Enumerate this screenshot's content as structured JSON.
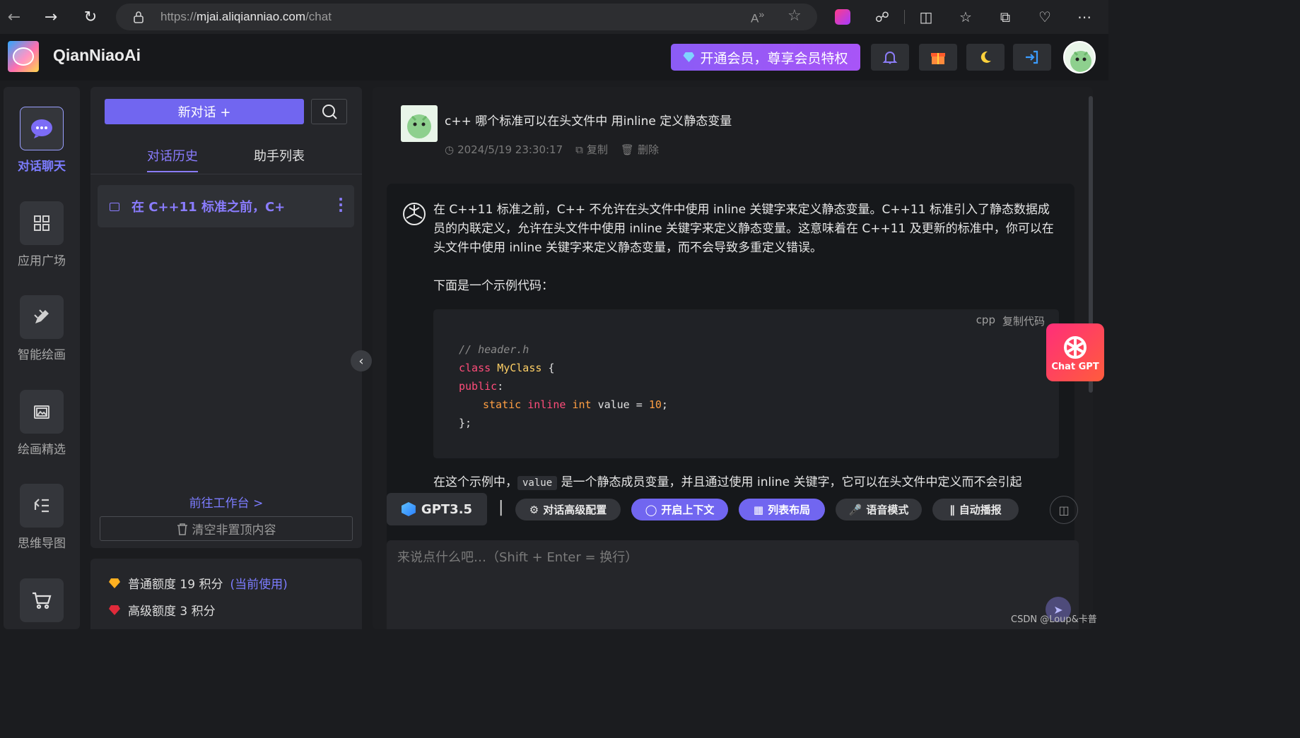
{
  "browser": {
    "url_prefix": "https://",
    "url_host": "mjai.aliqianniao.com",
    "url_path": "/chat"
  },
  "header": {
    "app_name": "QianNiaoAi",
    "vip_label": "开通会员，尊享会员特权"
  },
  "rail": {
    "items": [
      {
        "label": "对话聊天",
        "icon": "chat-bubble-icon",
        "active": true
      },
      {
        "label": "应用广场",
        "icon": "grid-icon"
      },
      {
        "label": "智能绘画",
        "icon": "paint-icon"
      },
      {
        "label": "绘画精选",
        "icon": "gallery-icon"
      },
      {
        "label": "思维导图",
        "icon": "mindmap-icon"
      },
      {
        "label": "",
        "icon": "cart-icon"
      }
    ]
  },
  "sessions": {
    "new_chat_label": "新对话 +",
    "tabs": [
      {
        "label": "对话历史",
        "active": true
      },
      {
        "label": "助手列表"
      }
    ],
    "items": [
      {
        "title": "在 C++11 标准之前，C+"
      }
    ],
    "goto_workspace": "前往工作台 >",
    "clear_label": "清空非置顶内容"
  },
  "quota": {
    "normal_label": "普通额度 19 积分",
    "current_tag": "(当前使用)",
    "advanced_label": "高级额度 3 积分"
  },
  "chat": {
    "user_message": "c++ 哪个标准可以在头文件中 用inline 定义静态变量",
    "timestamp": "2024/5/19 23:30:17",
    "copy_label": "复制",
    "delete_label": "删除",
    "ai_para1": "在 C++11 标准之前，C++ 不允许在头文件中使用 inline 关键字来定义静态变量。C++11 标准引入了静态数据成员的内联定义，允许在头文件中使用 inline 关键字来定义静态变量。这意味着在 C++11 及更新的标准中，你可以在头文件中使用 inline 关键字来定义静态变量，而不会导致多重定义错误。",
    "ai_para2": "下面是一个示例代码：",
    "code_lang": "cpp",
    "code_copy": "复制代码",
    "code": {
      "line1": "// header.h",
      "line2_kw": "class",
      "line2_name": "MyClass",
      "line2_brace": "{",
      "line3": "public",
      "line3_colon": ":",
      "line4_static": "static",
      "line4_inline": "inline",
      "line4_int": "int",
      "line4_var": "value",
      "line4_eq": "=",
      "line4_num": "10",
      "line4_semi": ";",
      "line5": "};"
    },
    "ai_para3_pre": "在这个示例中，",
    "ai_para3_code": "value",
    "ai_para3_post": "是一个静态成员变量，并且通过使用 inline 关键字，它可以在头文件中定义而不会引起"
  },
  "toolbar": {
    "model": "GPT3.5",
    "separator": "|",
    "config": "对话高级配置",
    "context": "开启上下文",
    "layout": "列表布局",
    "voice": "语音模式",
    "autoplay": "自动播报"
  },
  "input": {
    "placeholder": "来说点什么吧…（Shift + Enter = 换行）"
  },
  "float_badge": "Chat GPT",
  "watermark": "CSDN @Loup&卡普",
  "colors": {
    "accent": "#7166f0",
    "accent_text": "#8a7cff",
    "vip_gradient_start": "#8b5cf6",
    "vip_gradient_end": "#a855f7"
  }
}
